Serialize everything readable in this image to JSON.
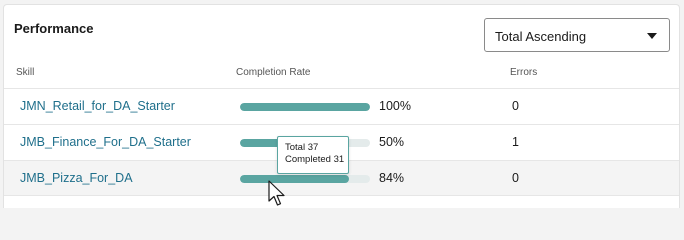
{
  "performance": {
    "title": "Performance",
    "sort": {
      "selected": "Total Ascending"
    },
    "columns": {
      "skill": "Skill",
      "completion_rate": "Completion Rate",
      "errors": "Errors"
    },
    "rows": [
      {
        "skill": "JMN_Retail_for_DA_Starter",
        "completion_rate": "100%",
        "completion_fraction": 1.0,
        "errors": "0"
      },
      {
        "skill": "JMB_Finance_For_DA_Starter",
        "completion_rate": "50%",
        "completion_fraction": 0.5,
        "errors": "1"
      },
      {
        "skill": "JMB_Pizza_For_DA",
        "completion_rate": "84%",
        "completion_fraction": 0.84,
        "errors": "0"
      }
    ],
    "tooltip": {
      "total": "Total 37",
      "completed": "Completed 31"
    }
  },
  "colors": {
    "link": "#1f6f8b",
    "bar_fill": "#5aa5a1",
    "bar_track": "#e4ebeb"
  },
  "icons": {
    "dropdown": "chevron-down-icon",
    "cursor": "mouse-pointer-icon"
  }
}
